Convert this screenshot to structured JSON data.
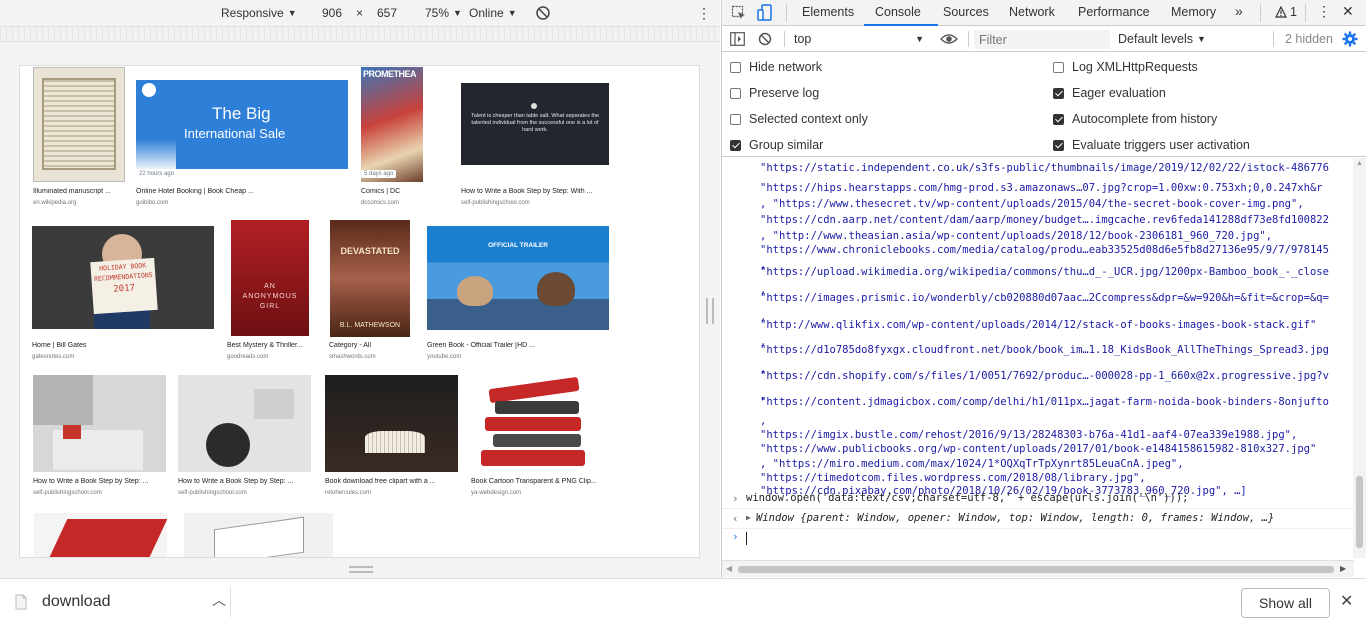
{
  "toolbar": {
    "device": "Responsive",
    "width": "906",
    "times": "×",
    "height": "657",
    "zoom": "75%",
    "throttle": "Online",
    "more": "⋮"
  },
  "results": {
    "r1": {
      "title": "Illuminated manuscript ...",
      "source": "en.wikipedia.org"
    },
    "r2": {
      "title": "Online Hotel Booking | Book Cheap ...",
      "source": "goibibo.com",
      "ago": "22 hours ago",
      "banner1": "The Big",
      "banner2": "International Sale"
    },
    "r3": {
      "title": "Comics | DC",
      "source": "dccomics.com",
      "ago": "5 days ago",
      "cover": "PROMETHEA"
    },
    "r4": {
      "title": "How to Write a Book Step by Step: With ...",
      "source": "self-publishingschool.com",
      "quote": "Talent is cheaper than table salt. What separates the talented individual from the successful one is a lot of hard work."
    },
    "r5": {
      "title": "Home | Bill Gates",
      "source": "gatesnotes.com",
      "sign1": "HOLIDAY BOOK",
      "sign2": "RECOMMENDATIONS",
      "sign3": "2017"
    },
    "r6": {
      "title": "Best Mystery & Thriller...",
      "source": "goodreads.com",
      "cover1": "AN",
      "cover2": "ANONYMOUS",
      "cover3": "GIRL"
    },
    "r7": {
      "title": "Category - All",
      "source": "smashwords.com",
      "cover1": "DEVASTATED",
      "cover2": "B.L. MATHEWSON"
    },
    "r8": {
      "title": "Green Book - Official Trailer [HD ...",
      "source": "youtube.com",
      "caption": "OFFICIAL TRAILER"
    },
    "r9": {
      "title": "How to Write a Book Step by Step: ...",
      "source": "self-publishingschool.com"
    },
    "r10": {
      "title": "How to Write a Book Step by Step: ...",
      "source": "self-publishingschool.com"
    },
    "r11": {
      "title": "Book download free clipart with a ...",
      "source": "retohercules.com"
    },
    "r12": {
      "title": "Book Cartoon Transparent & PNG Clip...",
      "source": "ya-webdesign.com"
    }
  },
  "devtools": {
    "tabs": [
      "Elements",
      "Console",
      "Sources",
      "Network",
      "Performance",
      "Memory"
    ],
    "more_tabs": "»",
    "warnings": "1",
    "context": "top",
    "filter_placeholder": "Filter",
    "levels": "Default levels",
    "hidden": "2 hidden"
  },
  "settings": {
    "hide_network": "Hide network",
    "preserve_log": "Preserve log",
    "selected_context": "Selected context only",
    "group_similar": "Group similar",
    "log_xhr": "Log XMLHttpRequests",
    "eager_eval": "Eager evaluation",
    "autocomplete": "Autocomplete from history",
    "triggers": "Evaluate triggers user activation",
    "checked": {
      "hide_network": false,
      "preserve_log": false,
      "selected_context": false,
      "group_similar": true,
      "log_xhr": false,
      "eager_eval": true,
      "autocomplete": true,
      "triggers": true
    }
  },
  "console": {
    "lines": [
      "\"https://static.independent.co.uk/s3fs-public/thumbnails/image/2019/12/02/22/istock-486776",
      "\"https://hips.hearstapps.com/hmg-prod.s3.amazonaws…07.jpg?crop=1.00xw:0.753xh;0,0.247xh&r",
      ", \"https://www.thesecret.tv/wp-content/uploads/2015/04/the-secret-book-cover-img.png\",",
      "\"https://cdn.aarp.net/content/dam/aarp/money/budget….imgcache.rev6feda141288df73e8fd100822",
      ", \"http://www.theasian.asia/wp-content/uploads/2018/12/book-2306181_960_720.jpg\",",
      "\"https://www.chroniclebooks.com/media/catalog/produ…eab33525d08d6e5fb8d27136e95/9/7/978145",
      ",",
      "\"https://upload.wikimedia.org/wikipedia/commons/thu…d_-_UCR.jpg/1200px-Bamboo_book_-_close",
      ",",
      "\"https://images.prismic.io/wonderbly/cb020880d07aac…2Ccompress&dpr=&w=920&h=&fit=&crop=&q=",
      ",",
      "\"http://www.qlikfix.com/wp-content/uploads/2014/12/stack-of-books-images-book-stack.gif\"",
      ",",
      "\"https://d1o785do8fyxgx.cloudfront.net/book/book_im…1.18_KidsBook_AllTheThings_Spread3.jpg",
      ",",
      "\"https://cdn.shopify.com/s/files/1/0051/7692/produc…-000028-pp-1_660x@2x.progressive.jpg?v",
      ",",
      "\"https://content.jdmagicbox.com/comp/delhi/h1/011px…jagat-farm-noida-book-binders-8onjufto",
      ",",
      "\"https://imgix.bustle.com/rehost/2016/9/13/28248303-b76a-41d1-aaf4-07ea339e1988.jpg\",",
      "\"https://www.publicbooks.org/wp-content/uploads/2017/01/book-e1484158615982-810x327.jpg\"",
      ", \"https://miro.medium.com/max/1024/1*OQXqTrTpXynrt85LeuaCnA.jpeg\",",
      "\"https://timedotcom.files.wordpress.com/2018/08/library.jpg\",",
      "\"https://cdn.pixabay.com/photo/2018/10/26/02/19/book-3773783_960_720.jpg\", …]"
    ],
    "command": "window.open('data:text/csv;charset=utf-8,' + escape(urls.join('\\n')));",
    "result": "Window {parent: Window, opener: Window, top: Window, length: 0, frames: Window, …}"
  },
  "shelf": {
    "download_name": "download",
    "show_all": "Show all",
    "close": "✕"
  }
}
